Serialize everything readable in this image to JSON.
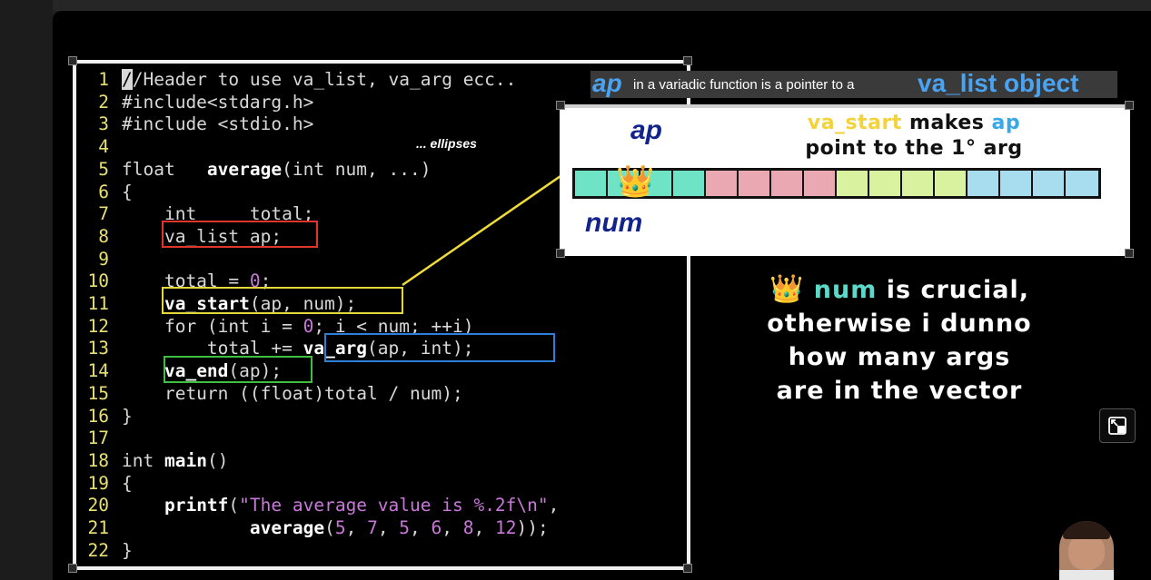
{
  "code": {
    "lines": [
      {
        "n": "1",
        "segs": [
          {
            "c": "cursor",
            "t": "/"
          },
          {
            "t": "/Header to use va_list, va_arg ecc.."
          }
        ]
      },
      {
        "n": "2",
        "segs": [
          {
            "t": "#include<stdarg.h>"
          }
        ]
      },
      {
        "n": "3",
        "segs": [
          {
            "t": "#include <stdio.h>"
          }
        ]
      },
      {
        "n": "4",
        "segs": []
      },
      {
        "n": "5",
        "segs": [
          {
            "t": "float   "
          },
          {
            "c": "fn",
            "t": "average"
          },
          {
            "t": "(int num, ...)"
          }
        ]
      },
      {
        "n": "6",
        "segs": [
          {
            "t": "{"
          }
        ]
      },
      {
        "n": "7",
        "segs": [
          {
            "t": "    int     total;"
          }
        ]
      },
      {
        "n": "8",
        "segs": [
          {
            "t": "    va_list ap;"
          }
        ]
      },
      {
        "n": "9",
        "segs": []
      },
      {
        "n": "10",
        "segs": [
          {
            "t": "    total = "
          },
          {
            "c": "num",
            "t": "0"
          },
          {
            "t": ";"
          }
        ]
      },
      {
        "n": "11",
        "segs": [
          {
            "t": "    "
          },
          {
            "c": "fn",
            "t": "va_start"
          },
          {
            "t": "(ap, num);"
          }
        ]
      },
      {
        "n": "12",
        "segs": [
          {
            "t": "    for (int i = "
          },
          {
            "c": "num",
            "t": "0"
          },
          {
            "t": "; i < num; ++i)"
          }
        ]
      },
      {
        "n": "13",
        "segs": [
          {
            "t": "        total += "
          },
          {
            "c": "fn",
            "t": "va_arg"
          },
          {
            "t": "(ap, int);"
          }
        ]
      },
      {
        "n": "14",
        "segs": [
          {
            "t": "    "
          },
          {
            "c": "fn",
            "t": "va_end"
          },
          {
            "t": "(ap);"
          }
        ]
      },
      {
        "n": "15",
        "segs": [
          {
            "t": "    return ((float)total / num);"
          }
        ]
      },
      {
        "n": "16",
        "segs": [
          {
            "t": "}"
          }
        ]
      },
      {
        "n": "17",
        "segs": []
      },
      {
        "n": "18",
        "segs": [
          {
            "t": "int "
          },
          {
            "c": "fn",
            "t": "main"
          },
          {
            "t": "()"
          }
        ]
      },
      {
        "n": "19",
        "segs": [
          {
            "t": "{"
          }
        ]
      },
      {
        "n": "20",
        "segs": [
          {
            "t": "    "
          },
          {
            "c": "fn",
            "t": "printf"
          },
          {
            "t": "("
          },
          {
            "c": "str",
            "t": "\"The average value is %.2f\\n\""
          },
          {
            "t": ","
          }
        ]
      },
      {
        "n": "21",
        "segs": [
          {
            "t": "            "
          },
          {
            "c": "fn",
            "t": "average"
          },
          {
            "t": "("
          },
          {
            "c": "num",
            "t": "5"
          },
          {
            "t": ", "
          },
          {
            "c": "num",
            "t": "7"
          },
          {
            "t": ", "
          },
          {
            "c": "num",
            "t": "5"
          },
          {
            "t": ", "
          },
          {
            "c": "num",
            "t": "6"
          },
          {
            "t": ", "
          },
          {
            "c": "num",
            "t": "8"
          },
          {
            "t": ", "
          },
          {
            "c": "num",
            "t": "12"
          },
          {
            "t": "));"
          }
        ]
      },
      {
        "n": "22",
        "segs": [
          {
            "t": "}"
          }
        ]
      }
    ],
    "ellipses_note": "... ellipses",
    "highlight_colors": {
      "va_list": "#e0352b",
      "va_start": "#e6d83a",
      "va_arg": "#2f7fd8",
      "va_end": "#3fbf3f"
    }
  },
  "banner": {
    "ap": "ap",
    "middle": " in a variadic function is a pointer to a ",
    "object": "va_list object"
  },
  "diagram": {
    "ap_label": "ap",
    "num_label": "num",
    "line1_a": "va_start",
    "line1_b": " makes ",
    "line1_c": "ap",
    "line2": "point to the 1° arg",
    "cell_colors": [
      "#6fe3c6",
      "#6fe3c6",
      "#6fe3c6",
      "#6fe3c6",
      "#eaa8b2",
      "#eaa8b2",
      "#eaa8b2",
      "#eaa8b2",
      "#d8f2a0",
      "#d8f2a0",
      "#d8f2a0",
      "#d8f2a0",
      "#a8ddf0",
      "#a8ddf0",
      "#a8ddf0",
      "#a8ddf0"
    ],
    "crown": "👑"
  },
  "caption": {
    "crown": "👑",
    "num": "num",
    "line1_rest": " is crucial,",
    "line2": "otherwise i dunno",
    "line3": "how many args",
    "line4": "are in the vector"
  },
  "icons": {
    "expand": "expand-icon"
  }
}
